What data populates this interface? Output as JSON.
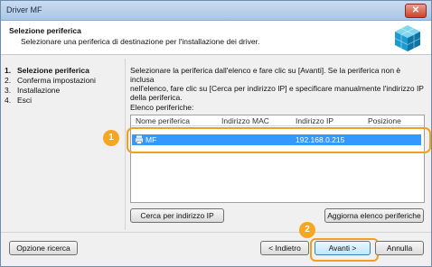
{
  "window": {
    "title": "Driver MF",
    "close_label": "✕"
  },
  "header": {
    "title": "Selezione periferica",
    "subtitle": "Selezionare una periferica di destinazione per l'installazione dei driver."
  },
  "steps": [
    {
      "num": "1.",
      "label": "Selezione periferica"
    },
    {
      "num": "2.",
      "label": "Conferma impostazioni"
    },
    {
      "num": "3.",
      "label": "Installazione"
    },
    {
      "num": "4.",
      "label": "Esci"
    }
  ],
  "description": {
    "line1": "Selezionare la periferica dall'elenco e fare clic su [Avanti]. Se la periferica non è inclusa",
    "line2": "nell'elenco, fare clic su [Cerca per indirizzo IP] e specificare manualmente l'indirizzo IP",
    "line3": "della periferica."
  },
  "device_list": {
    "label": "Elenco periferiche:",
    "columns": [
      "Nome periferica",
      "Indirizzo MAC",
      "Indirizzo IP",
      "Posizione"
    ],
    "rows": [
      {
        "name": "MF",
        "mac": "",
        "ip": "192.168.0.215",
        "location": ""
      }
    ]
  },
  "buttons": {
    "search_ip": "Cerca per indirizzo IP",
    "refresh": "Aggiorna elenco periferiche",
    "search_option": "Opzione ricerca",
    "back": "< Indietro",
    "next": "Avanti >",
    "cancel": "Annulla"
  },
  "callouts": {
    "one": "1",
    "two": "2"
  },
  "colors": {
    "accent": "#f5a623",
    "selection": "#3399ff"
  },
  "icons": {
    "header": "cube-icon",
    "device": "printer-icon"
  }
}
